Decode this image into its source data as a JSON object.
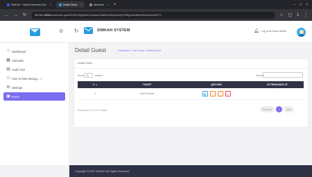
{
  "browser": {
    "tabs": [
      {
        "label": "SIMKAH - Sistem Informasi Kec",
        "active": false,
        "color": "#3b5bdb"
      },
      {
        "label": "Detail Guest",
        "active": true,
        "color": "#2b9adf"
      },
      {
        "label": "wikipedia",
        "active": false,
        "color": "#888888"
      }
    ],
    "url_host": "127.0.0.1:8000",
    "url_path": "/create/view-guest/3tLDfOp9QpWNiC/eeByhc/tJ4Mn8oZN9Q/bnz4SgYP0Bg/view/f8wr4Rl/3c0c5c/edit-ETL"
  },
  "header": {
    "app_title": "SIMKAH SYSTEM",
    "login_text": "Log in as Super Admin"
  },
  "sidebar": {
    "items": [
      {
        "label": "Dashboard",
        "icon": "home-icon",
        "active": false
      },
      {
        "label": "Calendar",
        "icon": "calendar-icon",
        "active": false
      },
      {
        "label": "Audit Trail",
        "icon": "document-icon",
        "active": false
      },
      {
        "label": "User & Role Manag... >",
        "icon": "users-icon",
        "active": false
      },
      {
        "label": "Settings",
        "icon": "gear-icon",
        "active": false
      },
      {
        "label": "Event",
        "icon": "grid-icon",
        "active": true
      }
    ]
  },
  "main": {
    "page_title": "Detail Guest",
    "breadcrumb": "Dashboard > List Guest > Detail Guest",
    "card_title": "Detail Guest",
    "show_label": "Show",
    "entries_value": "10",
    "entries_label": "entries",
    "search_label": "Search:",
    "table": {
      "headers": [
        "#",
        "TICKET",
        "QRCODE",
        "ATTENDANCE AT"
      ],
      "rows": [
        {
          "no": "1",
          "ticket": "Tiket Presisi",
          "attendance": "-"
        }
      ]
    },
    "showing_text": "Showing 1 to 1 of 1 entries",
    "pager": {
      "prev": "Previous",
      "page": "1",
      "next": "Next"
    }
  },
  "footer": {
    "text": "Copyright ©2025 SIMKAH All Rights Reserved"
  },
  "colors": {
    "accent": "#7b6cf0",
    "table_header": "#2f3145",
    "brand": "#2b9adf"
  }
}
